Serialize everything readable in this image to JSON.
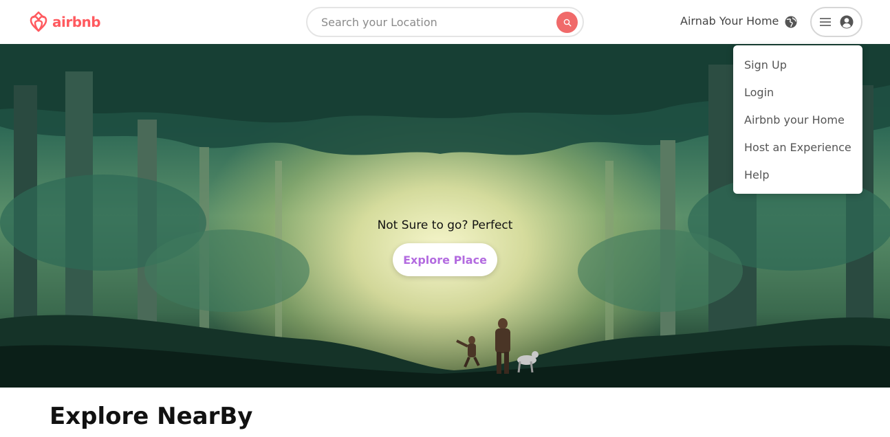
{
  "brand": {
    "name": "airbnb",
    "color": "#ff5a5f",
    "logo_icon": "airbnb-logo-icon"
  },
  "search": {
    "placeholder": "Search your Location",
    "value": "",
    "button_icon": "search-icon",
    "button_color": "#f06a6a"
  },
  "header": {
    "host_link": "Airnab Your Home",
    "globe_icon": "globe-icon",
    "menu_icon": "hamburger-icon",
    "avatar_icon": "user-avatar-icon"
  },
  "dropdown": {
    "items": [
      {
        "label": "Sign Up"
      },
      {
        "label": "Login"
      },
      {
        "label": "Airbnb your Home"
      },
      {
        "label": "Host an Experience"
      },
      {
        "label": "Help"
      }
    ]
  },
  "hero": {
    "caption": "Not Sure to go? Perfect",
    "button_label": "Explore Place",
    "button_color": "#b36be0"
  },
  "section": {
    "title": "Explore NearBy"
  }
}
